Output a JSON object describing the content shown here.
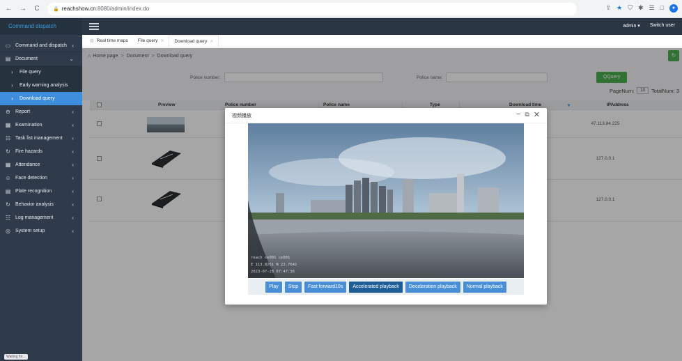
{
  "browser": {
    "url_host": "reachshow.cn",
    "url_path": ":8080/admin/index.do",
    "back": "←",
    "forward": "→",
    "reload": "C",
    "lock": "🔒"
  },
  "app": {
    "brand": "Command dispatch",
    "user": "admin ▾",
    "switch_user": "Switch user"
  },
  "sidebar": {
    "items": [
      {
        "label": "Command and dispatch",
        "icon": "monitor-icon",
        "glyph": "▭",
        "chev": "‹"
      },
      {
        "label": "Document",
        "icon": "folder-icon",
        "glyph": "▤",
        "chev": "⌄"
      },
      {
        "label": "File query",
        "icon": "chevron-right-icon",
        "glyph": "›",
        "chev": ""
      },
      {
        "label": "Early warning analysis",
        "icon": "chevron-right-icon",
        "glyph": "›",
        "chev": ""
      },
      {
        "label": "Download query",
        "icon": "chevron-right-icon",
        "glyph": "›",
        "chev": ""
      },
      {
        "label": "Report",
        "icon": "circle-icon",
        "glyph": "⊖",
        "chev": "‹"
      },
      {
        "label": "Examination",
        "icon": "calendar-icon",
        "glyph": "▦",
        "chev": "‹"
      },
      {
        "label": "Task list management",
        "icon": "tasks-icon",
        "glyph": "☷",
        "chev": "‹"
      },
      {
        "label": "Fire hazards",
        "icon": "sync-icon",
        "glyph": "↻",
        "chev": "‹"
      },
      {
        "label": "Attendance",
        "icon": "calendar-icon",
        "glyph": "▦",
        "chev": "‹"
      },
      {
        "label": "Face detection",
        "icon": "face-icon",
        "glyph": "☺",
        "chev": "‹"
      },
      {
        "label": "Plate recognition",
        "icon": "plate-icon",
        "glyph": "▤",
        "chev": "‹"
      },
      {
        "label": "Behavior analysis",
        "icon": "sync-icon",
        "glyph": "↻",
        "chev": "‹"
      },
      {
        "label": "Log management",
        "icon": "log-icon",
        "glyph": "☷",
        "chev": "‹"
      },
      {
        "label": "System setup",
        "icon": "globe-icon",
        "glyph": "◎",
        "chev": "‹"
      }
    ],
    "status_chip": "Waiting for..."
  },
  "tabs": [
    {
      "label": "Real time maps",
      "icon": "location-icon"
    },
    {
      "label": "File query"
    },
    {
      "label": "Download query"
    }
  ],
  "breadcrumb": {
    "home": "Home page",
    "level1": "Document",
    "level2": "Download query",
    "sep": ">"
  },
  "search": {
    "police_number_label": "Police number:",
    "police_name_label": "Police name:",
    "query_label": "QQuery",
    "page_num_label": "PageNum:",
    "page_num_value": "10",
    "total_num_label": "TotalNum: 3"
  },
  "table": {
    "headers": {
      "preview": "Preview",
      "police_number": "Police number",
      "police_name": "Police name",
      "type": "Type",
      "download_time": "Download time",
      "ip": "IPAddress"
    },
    "rows": [
      {
        "ip": "47.113.84.225",
        "thumb": "road"
      },
      {
        "ip": "127.0.0.1",
        "thumb": "phone"
      },
      {
        "ip": "127.0.0.1",
        "thumb": "phone"
      }
    ]
  },
  "modal": {
    "title": "视频播放",
    "osd_line1": "reach ce001 ce001",
    "osd_line2": "E 113.8261 N 22.7642",
    "osd_line3": "2023-07-28 07:47:36",
    "buttons": {
      "play": "Play",
      "stop": "Stop",
      "fast_forward": "Fast forward10s",
      "accelerated": "Accelerated playback",
      "deceleration": "Deceleration playback",
      "normal": "Normal playback"
    }
  }
}
